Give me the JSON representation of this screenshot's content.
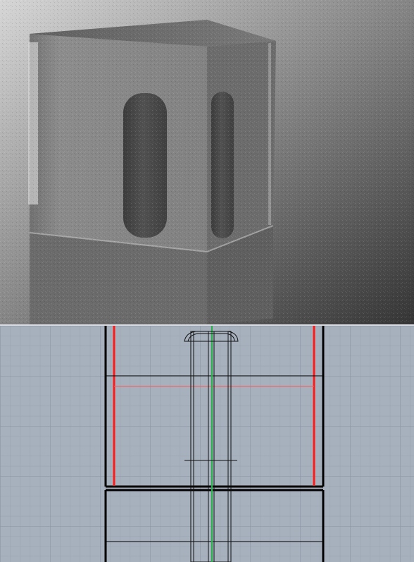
{
  "app": {
    "top_view": "render-preview",
    "bottom_view": "cad-construction-view"
  },
  "colors": {
    "render_bg_top": "#cfcfcf",
    "render_bg_bottom": "#3c3c3c",
    "glass": "#9a9a9a",
    "pedestal": "#6e6e6e",
    "cylinder": "#4c4c4c",
    "cad_bg": "#a7b0bd",
    "cad_grid": "#95a0ae",
    "cad_major_grid": "#8994a3",
    "cad_line": "#000000",
    "cad_red": "#ff1a1a",
    "cad_green": "#27b14a"
  }
}
